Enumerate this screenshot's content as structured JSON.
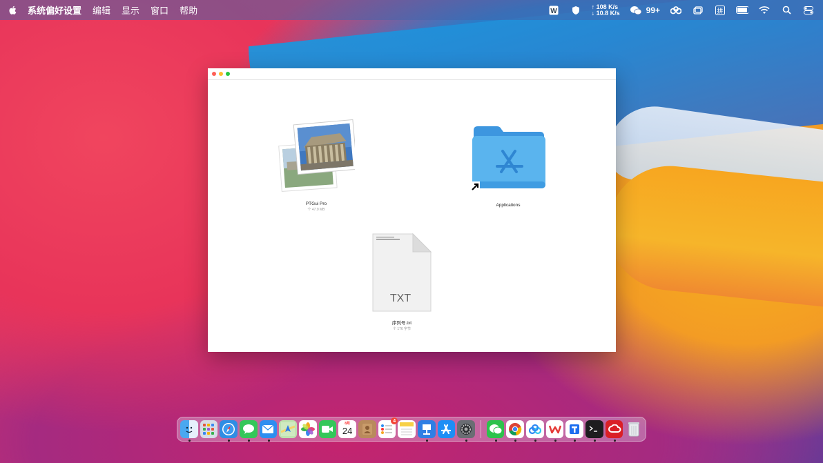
{
  "menubar": {
    "app_name": "系统偏好设置",
    "items": [
      "编辑",
      "显示",
      "窗口",
      "帮助"
    ],
    "net_up": "↑ 108 K/s",
    "net_down": "↓ 10.8 K/s",
    "wechat_count": "99+"
  },
  "window": {
    "files": [
      {
        "name": "PTGui Pro",
        "meta": "个 47.9 MB"
      },
      {
        "name": "Applications",
        "meta": ""
      },
      {
        "name": "序列号.txt",
        "meta": "个 176 字节",
        "ext_label": "TXT"
      }
    ]
  },
  "dock": {
    "calendar_month": "8月",
    "calendar_day": "24",
    "reminders_badge": "4",
    "items": [
      "finder",
      "launchpad",
      "safari",
      "messages",
      "mail",
      "maps",
      "photos",
      "facetime",
      "calendar",
      "contacts",
      "reminders",
      "notes",
      "keynote",
      "app-store",
      "system-preferences",
      "wechat",
      "chrome",
      "baidu-netdisk",
      "wps",
      "tencent-docs",
      "terminal",
      "creative-cloud",
      "trash"
    ]
  },
  "colors": {
    "accent_blue": "#1d95dd",
    "folder_blue": "#5ab4ee",
    "orange": "#f7a620"
  }
}
